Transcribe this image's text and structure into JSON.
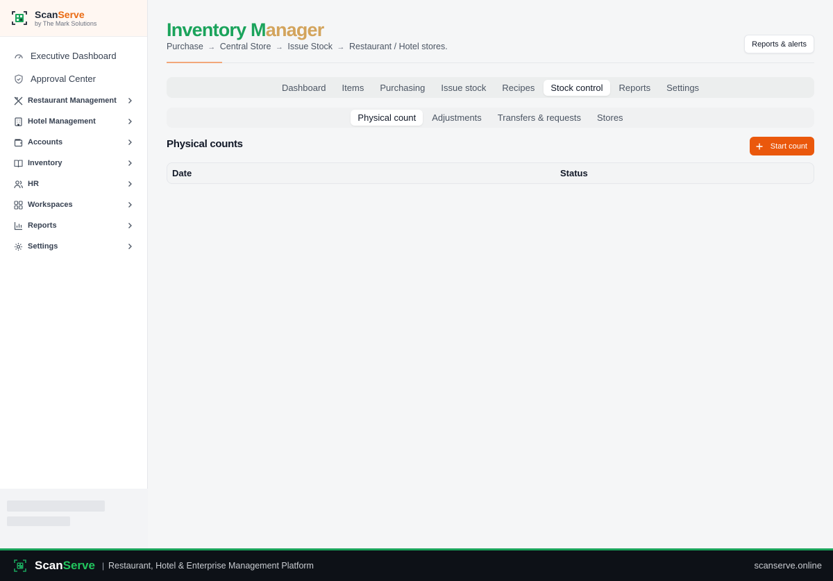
{
  "brand": {
    "name_part1": "Scan",
    "name_part2": "Serve",
    "subtitle": "by The Mark Solutions"
  },
  "sidebar": {
    "top_items": [
      {
        "label": "Executive Dashboard",
        "icon": "gauge-icon"
      },
      {
        "label": "Approval Center",
        "icon": "shield-check-icon"
      }
    ],
    "groups": [
      {
        "label": "Restaurant Management",
        "icon": "utensils-icon"
      },
      {
        "label": "Hotel Management",
        "icon": "building-icon"
      },
      {
        "label": "Accounts",
        "icon": "wallet-icon"
      },
      {
        "label": "Inventory",
        "icon": "book-icon"
      },
      {
        "label": "HR",
        "icon": "users-icon"
      },
      {
        "label": "Workspaces",
        "icon": "grid-icon"
      },
      {
        "label": "Reports",
        "icon": "bar-chart-icon"
      },
      {
        "label": "Settings",
        "icon": "gear-icon"
      }
    ]
  },
  "header": {
    "title_part1": "Inventory M",
    "title_part2": "anager",
    "breadcrumb": [
      "Purchase",
      "Central Store",
      "Issue Stock",
      "Restaurant / Hotel stores."
    ],
    "breadcrumb_arrow": "→",
    "reports_button": "Reports & alerts"
  },
  "tabs": {
    "items": [
      "Dashboard",
      "Items",
      "Purchasing",
      "Issue stock",
      "Recipes",
      "Stock control",
      "Reports",
      "Settings"
    ],
    "active": "Stock control"
  },
  "subtabs": {
    "items": [
      "Physical count",
      "Adjustments",
      "Transfers & requests",
      "Stores"
    ],
    "active": "Physical count"
  },
  "section": {
    "title": "Physical counts",
    "start_button": "Start count",
    "columns": [
      "Date",
      "Status"
    ]
  },
  "footer": {
    "name_part1": "Scan",
    "name_part2": "Serve",
    "separator": "|",
    "tagline": "Restaurant, Hotel & Enterprise Management Platform",
    "site": "scanserve.online"
  },
  "colors": {
    "accent": "#ea580c",
    "brand_green": "#1aa35b",
    "footer_bg": "#0d1117"
  }
}
